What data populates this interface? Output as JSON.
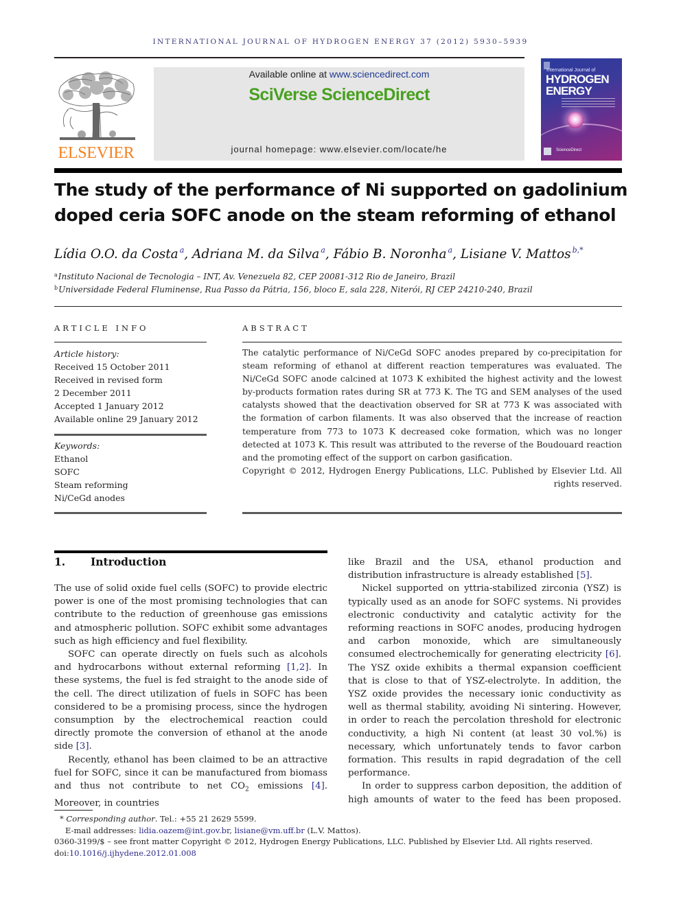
{
  "running_head": "INTERNATIONAL JOURNAL OF HYDROGEN ENERGY 37 (2012) 5930–5939",
  "masthead": {
    "publisher_logo_text": "ELSEVIER",
    "available_online_prefix": "Available online at ",
    "available_online_link": "www.sciencedirect.com",
    "brand": "SciVerse ScienceDirect",
    "homepage": "journal homepage: www.elsevier.com/locate/he",
    "cover": {
      "subtitle": "International Journal of",
      "title_line1": "HYDROGEN",
      "title_line2": "ENERGY",
      "footer": "ScienceDirect"
    },
    "colors": {
      "elsevier_orange": "#f58220",
      "sciencedirect_green": "#48a01f",
      "link_blue": "#2b2b8a"
    }
  },
  "article": {
    "title": "The study of the performance of Ni supported on gadolinium doped ceria SOFC anode on the steam reforming of ethanol",
    "authors": [
      {
        "name": "Lídia O.O. da Costa",
        "affil": "a"
      },
      {
        "name": "Adriana M. da Silva",
        "affil": "a"
      },
      {
        "name": "Fábio B. Noronha",
        "affil": "a"
      },
      {
        "name": "Lisiane V. Mattos",
        "affil": "b,*"
      }
    ],
    "affiliations": [
      {
        "mark": "a",
        "text": "Instituto Nacional de Tecnologia – INT, Av. Venezuela 82, CEP 20081-312 Rio de Janeiro, Brazil"
      },
      {
        "mark": "b",
        "text": "Universidade Federal Fluminense, Rua Passo da Pátria, 156, bloco E, sala 228, Niterói, RJ CEP 24210-240, Brazil"
      }
    ]
  },
  "article_info": {
    "heading": "ARTICLE INFO",
    "history_label": "Article history:",
    "history": [
      "Received 15 October 2011",
      "Received in revised form",
      "2 December 2011",
      "Accepted 1 January 2012",
      "Available online 29 January 2012"
    ],
    "keywords_label": "Keywords:",
    "keywords": [
      "Ethanol",
      "SOFC",
      "Steam reforming",
      "Ni/CeGd anodes"
    ]
  },
  "abstract": {
    "heading": "ABSTRACT",
    "text": "The catalytic performance of Ni/CeGd SOFC anodes prepared by co-precipitation for steam reforming of ethanol at different reaction temperatures was evaluated. The Ni/CeGd SOFC anode calcined at 1073 K exhibited the highest activity and the lowest by-products formation rates during SR at 773 K. The TG and SEM analyses of the used catalysts showed that the deactivation observed for SR at 773 K was associated with the formation of carbon filaments. It was also observed that the increase of reaction temperature from 773 to 1073 K decreased coke formation, which was no longer detected at 1073 K. This result was attributed to the reverse of the Boudouard reaction and the promoting effect of the support on carbon gasification.",
    "copyright": "Copyright © 2012, Hydrogen Energy Publications, LLC. Published by Elsevier Ltd. All rights reserved."
  },
  "introduction": {
    "number": "1.",
    "heading": "Introduction",
    "left_column": [
      {
        "indent": false,
        "parts": [
          "The use of solid oxide fuel cells (SOFC) to provide electric power is one of the most promising technologies that can contribute to the reduction of greenhouse gas emissions and atmospheric pollution. SOFC exhibit some advantages such as high efficiency and fuel flexibility."
        ]
      },
      {
        "indent": true,
        "parts": [
          "SOFC can operate directly on fuels such as alcohols and hydrocarbons without external reforming ",
          "[1,2]",
          ". In these systems, the fuel is fed straight to the anode side of the cell. The direct utilization of fuels in SOFC has been considered to be a promising process, since the hydrogen consumption by the electrochemical reaction could directly promote the conversion of ethanol at the anode side ",
          "[3]",
          "."
        ]
      },
      {
        "indent": true,
        "parts": [
          "Recently, ethanol has been claimed to be an attractive fuel for SOFC, since it can be manufactured from biomass and thus not contribute to net CO",
          "2",
          " emissions ",
          "[4]",
          ". Moreover, in countries"
        ]
      }
    ],
    "right_column": [
      {
        "indent": false,
        "parts": [
          "like Brazil and the USA, ethanol production and distribution infrastructure is already established ",
          "[5]",
          "."
        ]
      },
      {
        "indent": true,
        "parts": [
          "Nickel supported on yttria-stabilized zirconia (YSZ) is typically used as an anode for SOFC systems. Ni provides electronic conductivity and catalytic activity for the reforming reactions in SOFC anodes, producing hydrogen and carbon monoxide, which are simultaneously consumed electrochemically for generating electricity ",
          "[6]",
          ". The YSZ oxide exhibits a thermal expansion coefficient that is close to that of YSZ-electrolyte. In addition, the YSZ oxide provides the necessary ionic conductivity as well as thermal stability, avoiding Ni sintering. However, in order to reach the percolation threshold for electronic conductivity, a high Ni content (at least 30 vol.%) is necessary, which unfortunately tends to favor carbon formation. This results in rapid degradation of the cell performance."
        ]
      },
      {
        "indent": true,
        "parts": [
          "In order to suppress carbon deposition, the addition of high amounts of water to the feed has been proposed."
        ]
      }
    ]
  },
  "footnotes": {
    "corresponding_mark": "*",
    "corresponding_label": "Corresponding author",
    "tel": ". Tel.: +55 21 2629 5599.",
    "email_label": "E-mail addresses: ",
    "email1": "lidia.oazem@int.gov.br",
    "email_sep": ", ",
    "email2": "lisiane@vm.uff.br",
    "email_suffix": " (L.V. Mattos).",
    "front_matter": "0360-3199/$ – see front matter Copyright © 2012, Hydrogen Energy Publications, LLC. Published by Elsevier Ltd. All rights reserved.",
    "doi_label": "doi:",
    "doi": "10.1016/j.ijhydene.2012.01.008"
  }
}
